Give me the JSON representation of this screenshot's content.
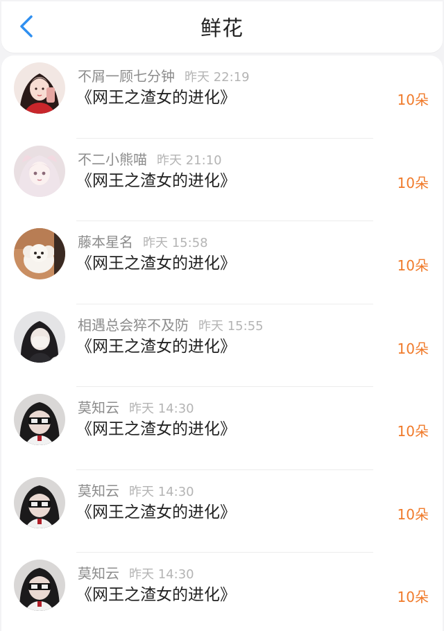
{
  "header": {
    "title": "鲜花",
    "back_icon": "chevron-left-icon"
  },
  "colors": {
    "accent_blue": "#2f8ff0",
    "flower_orange": "#f07a2a",
    "username_gray": "#8c8c8c",
    "timestamp_gray": "#b4b4b4"
  },
  "records": [
    {
      "username": "不屑一顾七分钟",
      "time": "昨天 22:19",
      "book": "《网王之渣女的进化》",
      "count": "10朵"
    },
    {
      "username": "不二小熊喵",
      "time": "昨天 21:10",
      "book": "《网王之渣女的进化》",
      "count": "10朵"
    },
    {
      "username": "藤本星名",
      "time": "昨天 15:58",
      "book": "《网王之渣女的进化》",
      "count": "10朵"
    },
    {
      "username": "相遇总会猝不及防",
      "time": "昨天 15:55",
      "book": "《网王之渣女的进化》",
      "count": "10朵"
    },
    {
      "username": "莫知云",
      "time": "昨天 14:30",
      "book": "《网王之渣女的进化》",
      "count": "10朵"
    },
    {
      "username": "莫知云",
      "time": "昨天 14:30",
      "book": "《网王之渣女的进化》",
      "count": "10朵"
    },
    {
      "username": "莫知云",
      "time": "昨天 14:30",
      "book": "《网王之渣女的进化》",
      "count": "10朵"
    }
  ]
}
